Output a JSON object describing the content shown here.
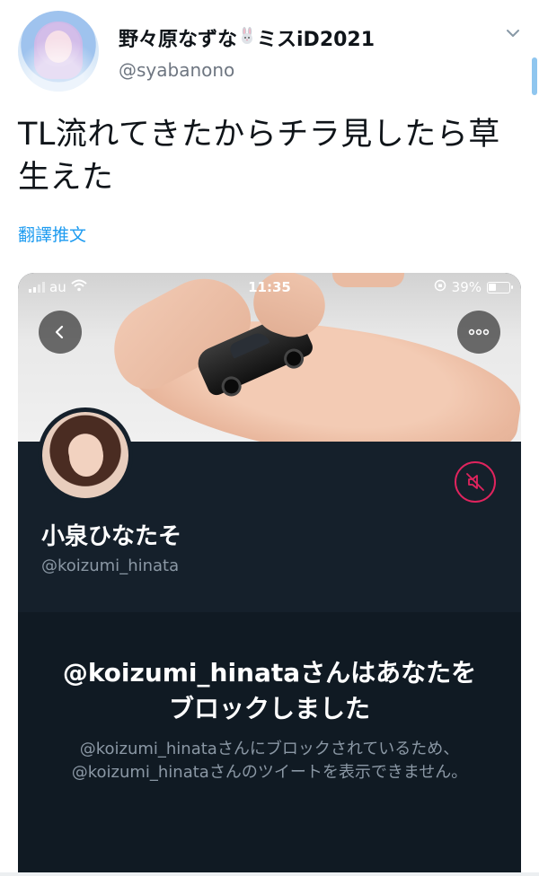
{
  "tweet": {
    "author_name": "野々原なずな",
    "author_emoji": "🐰",
    "author_suffix": "ミスiD2021",
    "author_handle": "@syabanono",
    "text": "TL流れてきたからチラ見したら草生えた",
    "translate_link": "翻譯推文"
  },
  "embedded_screenshot": {
    "status_bar": {
      "carrier": "au",
      "time": "11:35",
      "battery_percent": "39%"
    },
    "profile": {
      "display_name": "小泉ひなたそ",
      "handle": "@koizumi_hinata"
    },
    "blocked_notice": {
      "title": "@koizumi_hinataさんはあなたをブロックしました",
      "description": "@koizumi_hinataさんにブロックされているため、@koizumi_hinataさんのツイートを表示できません。"
    }
  },
  "icons": {
    "menu": "chevron-down-icon",
    "back": "back-arrow-icon",
    "more": "more-icon",
    "mute": "muted-speaker-icon",
    "wifi": "wifi-icon",
    "signal": "signal-icon",
    "battery": "battery-icon",
    "rotation_lock": "rotation-lock-icon"
  },
  "colors": {
    "link_blue": "#1d9bf0",
    "mute_red": "#e0245e",
    "dark_bg": "#15202b"
  }
}
